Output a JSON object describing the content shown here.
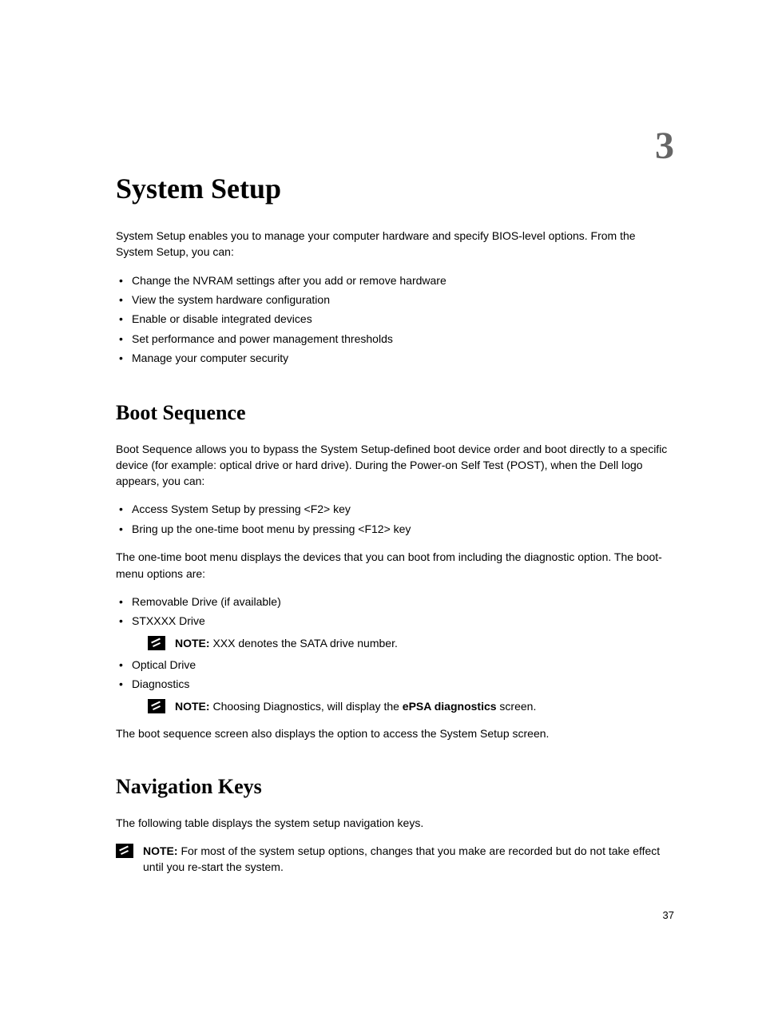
{
  "chapterNumber": "3",
  "title": "System Setup",
  "intro": "System Setup enables you to manage your computer hardware and specify BIOS-level options. From the System Setup, you can:",
  "introList": [
    "Change the NVRAM settings after you add or remove hardware",
    "View the system hardware configuration",
    "Enable or disable integrated devices",
    "Set performance and power management thresholds",
    "Manage your computer security"
  ],
  "bootSeq": {
    "heading": "Boot Sequence",
    "p1": "Boot Sequence allows you to bypass the System Setup-defined boot device order and boot directly to a specific device (for example: optical drive or hard drive). During the Power-on Self Test (POST), when the Dell logo appears, you can:",
    "list1": [
      "Access System Setup by pressing <F2> key",
      "Bring up the one-time boot menu by pressing <F12> key"
    ],
    "p2": "The one-time boot menu displays the devices that you can boot from including the diagnostic option. The boot-menu options are:",
    "list2": {
      "item1": "Removable Drive (if available)",
      "item2": "STXXXX Drive",
      "note1Label": "NOTE: ",
      "note1Text": "XXX denotes the SATA drive number.",
      "item3": "Optical Drive",
      "item4": "Diagnostics",
      "note2Label": "NOTE: ",
      "note2TextA": "Choosing Diagnostics, will display the ",
      "note2Bold": "ePSA diagnostics",
      "note2TextB": " screen."
    },
    "p3": "The boot sequence screen also displays the option to access the System Setup screen."
  },
  "navKeys": {
    "heading": "Navigation Keys",
    "p1": "The following table displays the system setup navigation keys.",
    "noteLabel": "NOTE: ",
    "noteText": "For most of the system setup options, changes that you make are recorded but do not take effect until you re-start the system."
  },
  "pageNumber": "37"
}
